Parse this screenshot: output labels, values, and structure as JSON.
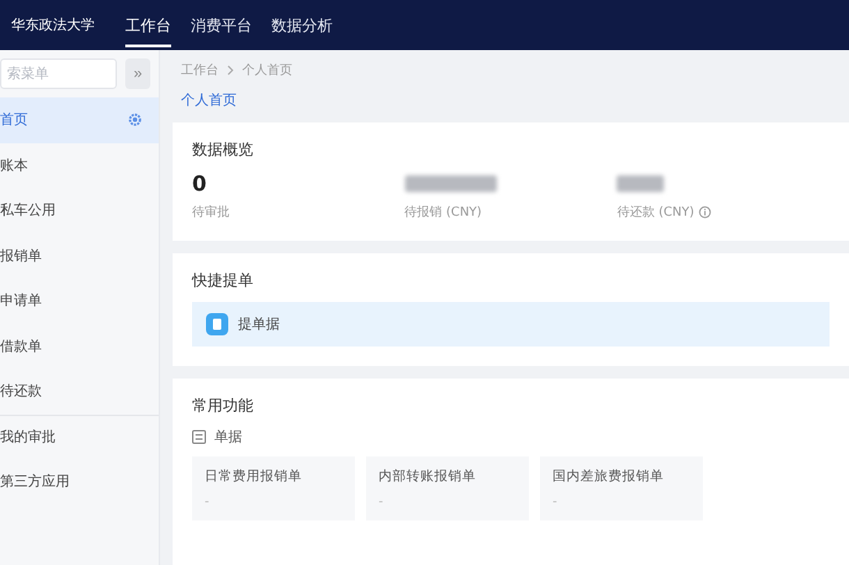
{
  "header": {
    "brand": "华东政法大学",
    "nav": [
      {
        "label": "工作台",
        "selected": true
      },
      {
        "label": "消费平台",
        "selected": false
      },
      {
        "label": "数据分析",
        "selected": false
      }
    ]
  },
  "sidebar": {
    "search": {
      "placeholder": "索菜单"
    },
    "collapse": "»",
    "items": [
      {
        "label": "首页",
        "selected": true,
        "divider_after": false
      },
      {
        "label": "账本",
        "selected": false,
        "divider_after": false
      },
      {
        "label": "私车公用",
        "selected": false,
        "divider_after": false
      },
      {
        "label": "报销单",
        "selected": false,
        "divider_after": false
      },
      {
        "label": "申请单",
        "selected": false,
        "divider_after": false
      },
      {
        "label": "借款单",
        "selected": false,
        "divider_after": false
      },
      {
        "label": "待还款",
        "selected": false,
        "divider_after": true
      },
      {
        "label": "我的审批",
        "selected": false,
        "divider_after": false
      },
      {
        "label": "第三方应用",
        "selected": false,
        "divider_after": false
      }
    ]
  },
  "breadcrumb": [
    "工作台",
    "个人首页"
  ],
  "page_title": "个人首页",
  "overview": {
    "title": "数据概览",
    "stats": [
      {
        "kind": "number",
        "value": "0",
        "label": "待审批",
        "info": false
      },
      {
        "kind": "blurred",
        "label": "待报销 (CNY)",
        "info": false
      },
      {
        "kind": "blurred",
        "label": "待还款 (CNY)",
        "info": true
      }
    ]
  },
  "quick": {
    "title": "快捷提单",
    "action": "提单据"
  },
  "common": {
    "title": "常用功能",
    "group": "单据",
    "tiles": [
      {
        "title": "日常费用报销单",
        "sub": "-"
      },
      {
        "title": "内部转账报销单",
        "sub": "-"
      },
      {
        "title": "国内差旅费报销单",
        "sub": "-"
      }
    ]
  }
}
